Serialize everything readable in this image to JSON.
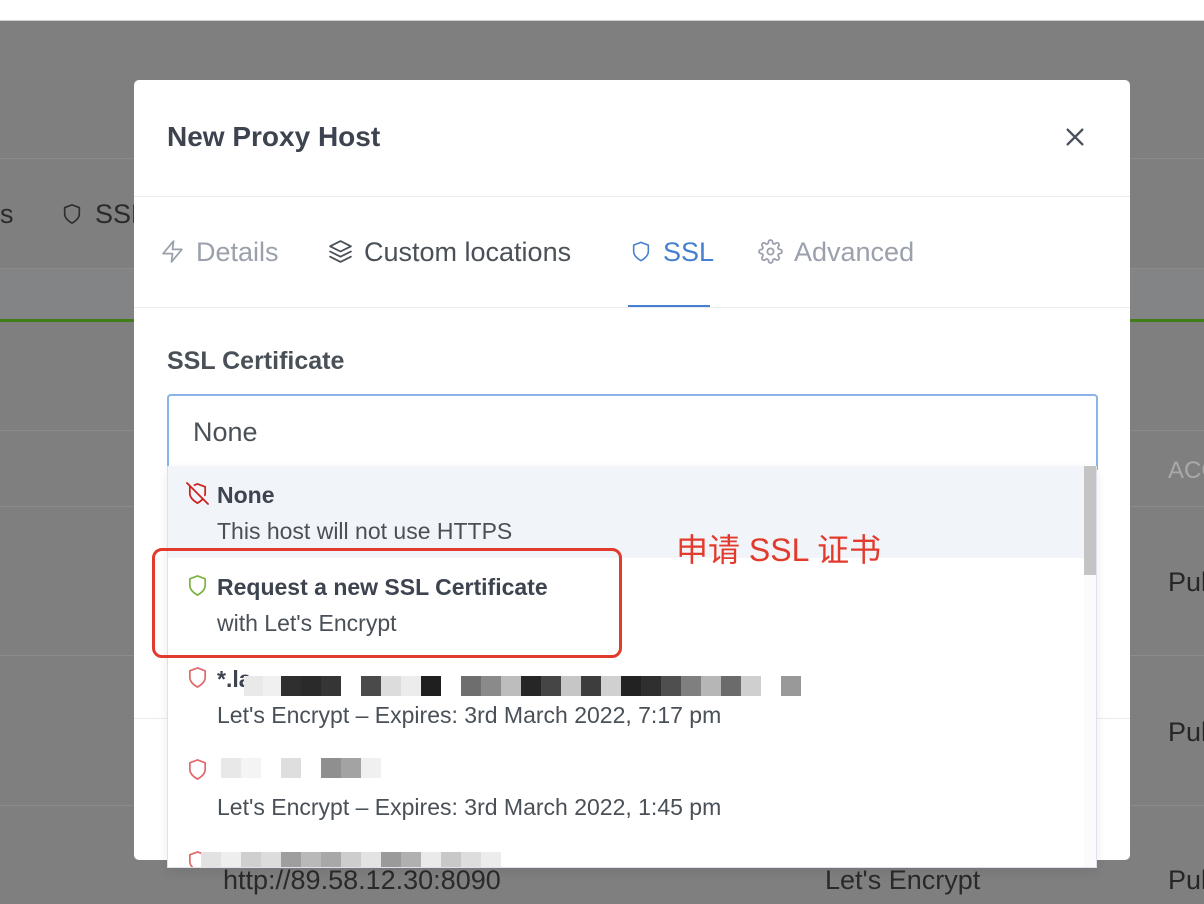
{
  "background": {
    "tabs": [
      {
        "label": "s"
      },
      {
        "label": "SSL",
        "icon": "shield-icon"
      }
    ],
    "table": {
      "header_right": "ACC",
      "rows": [
        {
          "access": "Pul"
        },
        {
          "access": "Pul"
        },
        {
          "destination": "http://89.58.12.30:8090",
          "ssl": "Let's Encrypt",
          "access": "Pul"
        }
      ]
    }
  },
  "modal": {
    "title": "New Proxy Host",
    "close_icon": "close-icon",
    "tabs": [
      {
        "label": "Details",
        "icon": "lightning-icon",
        "active": false
      },
      {
        "label": "Custom locations",
        "icon": "layers-icon",
        "active": false
      },
      {
        "label": "SSL",
        "icon": "shield-icon",
        "active": true
      },
      {
        "label": "Advanced",
        "icon": "gear-icon",
        "active": false
      }
    ],
    "ssl_certificate": {
      "label": "SSL Certificate",
      "selected": "None",
      "options": [
        {
          "title": "None",
          "subtitle": "This host will not use HTTPS",
          "icon": "shield-off-icon",
          "highlighted": true
        },
        {
          "title": "Request a new SSL Certificate",
          "subtitle": "with Let's Encrypt",
          "icon": "shield-icon"
        },
        {
          "title": "*.la",
          "subtitle": "Let's Encrypt – Expires: 3rd March 2022, 7:17 pm",
          "icon": "shield-icon"
        },
        {
          "subtitle": "Let's Encrypt – Expires: 3rd March 2022, 1:45 pm",
          "icon": "shield-icon"
        },
        {
          "icon": "shield-icon"
        }
      ]
    }
  },
  "annotation": {
    "text": "申请 SSL 证书"
  },
  "colors": {
    "accent": "#467fcf",
    "tab_inactive": "#9aa0ac",
    "text": "#495057",
    "shield_off": "#cd201f",
    "shield_request": "#7cb342",
    "shield_certificate": "#e06a6e",
    "annotation": "#e23b2d",
    "backdrop": "#7f7f7f"
  }
}
